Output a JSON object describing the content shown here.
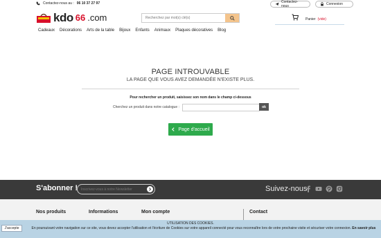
{
  "topbar": {
    "contact_prefix": "Contactez-nous au :",
    "phone": "06 10 37 27 97",
    "contact_button": "Contactez-nous",
    "login_button": "Connexion"
  },
  "header": {
    "logo_main": "kdo",
    "logo_number": "66",
    "logo_suffix": ".com",
    "search_placeholder": "Recherchez par mot(s) clé(s)",
    "cart_label": "Panier",
    "cart_status": "(vide)"
  },
  "nav": {
    "items": [
      "Cadeaux",
      "Décorations",
      "Arts de la table",
      "Bijoux",
      "Enfants",
      "Animaux",
      "Plaques décoratives",
      "Blog"
    ]
  },
  "error": {
    "title": "PAGE INTROUVABLE",
    "subtitle": "LA PAGE QUE VOUS AVEZ DEMANDÉE N'EXISTE PLUS.",
    "hint": "Pour rechercher un produit, saisissez son nom dans le champ ci-dessous",
    "catalogue_label": "Cherchez un produit dans notre catalogue :",
    "ok_label": "ok",
    "home_button": "Page d'accueil"
  },
  "newsletter": {
    "title": "S'abonner !",
    "placeholder": "Inscrivez-vous à notre Newsletter",
    "follow": "Suivez-nous"
  },
  "footer": {
    "columns": [
      "Nos produits",
      "Informations",
      "Mon compte",
      "Contact"
    ]
  },
  "cookie": {
    "accept": "J'accepte",
    "title": "UTILISATION DES COOKIES.",
    "text": "En poursuivant votre navigation sur ce site, vous devez accepter l'utilisation et l'écriture de Cookies sur votre appareil connecté pour vous reconnaître lors de votre prochaine visite et sécuriser votre connexion.",
    "more": "En savoir plus"
  },
  "colors": {
    "brand_red": "#d8102a",
    "search_button": "#f4c48c",
    "home_button": "#2eaa4c",
    "newsletter_band": "#3a3a3a",
    "cookie_bar": "#b9d3e4"
  }
}
